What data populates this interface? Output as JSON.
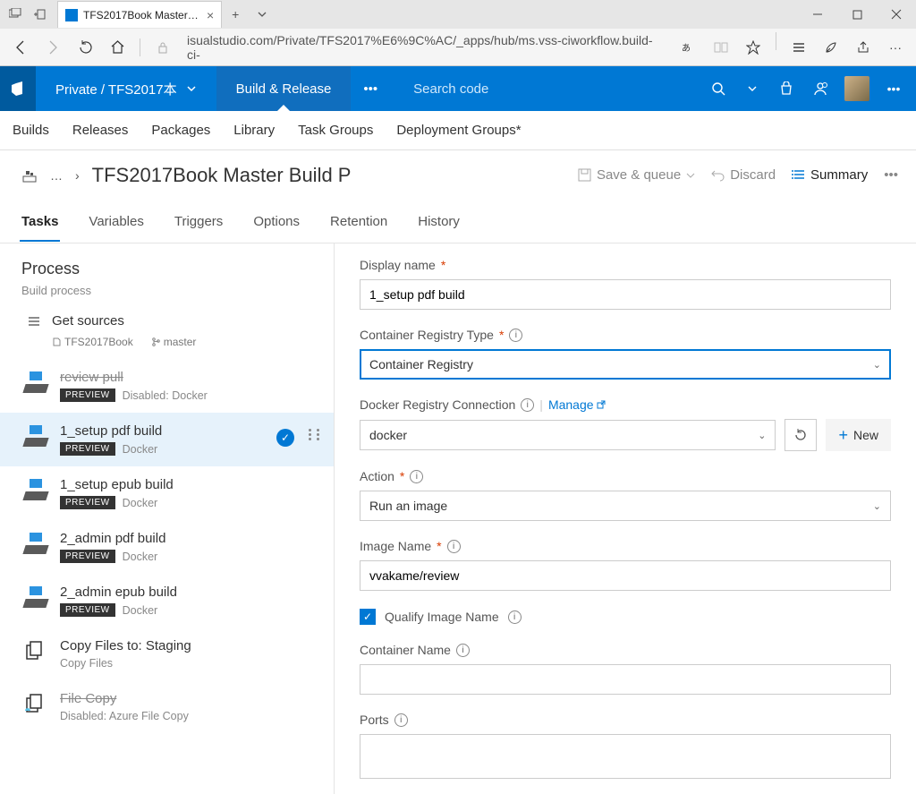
{
  "browser": {
    "tab_title": "TFS2017Book Master Bu",
    "url": "isualstudio.com/Private/TFS2017%E6%9C%AC/_apps/hub/ms.vss-ciworkflow.build-ci-"
  },
  "tfsnav": {
    "breadcrumb": "Private / TFS2017本",
    "active_section": "Build & Release",
    "search_placeholder": "Search code"
  },
  "subnav": [
    "Builds",
    "Releases",
    "Packages",
    "Library",
    "Task Groups",
    "Deployment Groups*"
  ],
  "page_title": "TFS2017Book Master Build P",
  "title_actions": {
    "save": "Save & queue",
    "discard": "Discard",
    "summary": "Summary"
  },
  "page_tabs": [
    "Tasks",
    "Variables",
    "Triggers",
    "Options",
    "Retention",
    "History"
  ],
  "active_page_tab": "Tasks",
  "process": {
    "heading": "Process",
    "sub": "Build process",
    "get_sources": "Get sources",
    "repo": "TFS2017Book",
    "branch": "master"
  },
  "tasks": [
    {
      "name": "review pull",
      "type": "Disabled: Docker",
      "preview": "PREVIEW",
      "disabled": true,
      "selected": false,
      "icon": "docker"
    },
    {
      "name": "1_setup pdf build",
      "type": "Docker",
      "preview": "PREVIEW",
      "disabled": false,
      "selected": true,
      "icon": "docker"
    },
    {
      "name": "1_setup epub build",
      "type": "Docker",
      "preview": "PREVIEW",
      "disabled": false,
      "selected": false,
      "icon": "docker"
    },
    {
      "name": "2_admin pdf build",
      "type": "Docker",
      "preview": "PREVIEW",
      "disabled": false,
      "selected": false,
      "icon": "docker"
    },
    {
      "name": "2_admin epub build",
      "type": "Docker",
      "preview": "PREVIEW",
      "disabled": false,
      "selected": false,
      "icon": "docker"
    },
    {
      "name": "Copy Files to: Staging",
      "type": "Copy Files",
      "preview": "",
      "disabled": false,
      "selected": false,
      "icon": "copy"
    },
    {
      "name": "File Copy",
      "type": "Disabled: Azure File Copy",
      "preview": "",
      "disabled": true,
      "selected": false,
      "icon": "copy"
    }
  ],
  "form": {
    "display_name": {
      "label": "Display name",
      "value": "1_setup pdf build"
    },
    "registry_type": {
      "label": "Container Registry Type",
      "value": "Container Registry"
    },
    "registry_conn": {
      "label": "Docker Registry Connection",
      "value": "docker",
      "manage": "Manage",
      "new": "New"
    },
    "action": {
      "label": "Action",
      "value": "Run an image"
    },
    "image_name": {
      "label": "Image Name",
      "value": "vvakame/review"
    },
    "qualify": {
      "label": "Qualify Image Name",
      "checked": true
    },
    "container_name": {
      "label": "Container Name",
      "value": ""
    },
    "ports": {
      "label": "Ports",
      "value": ""
    }
  }
}
